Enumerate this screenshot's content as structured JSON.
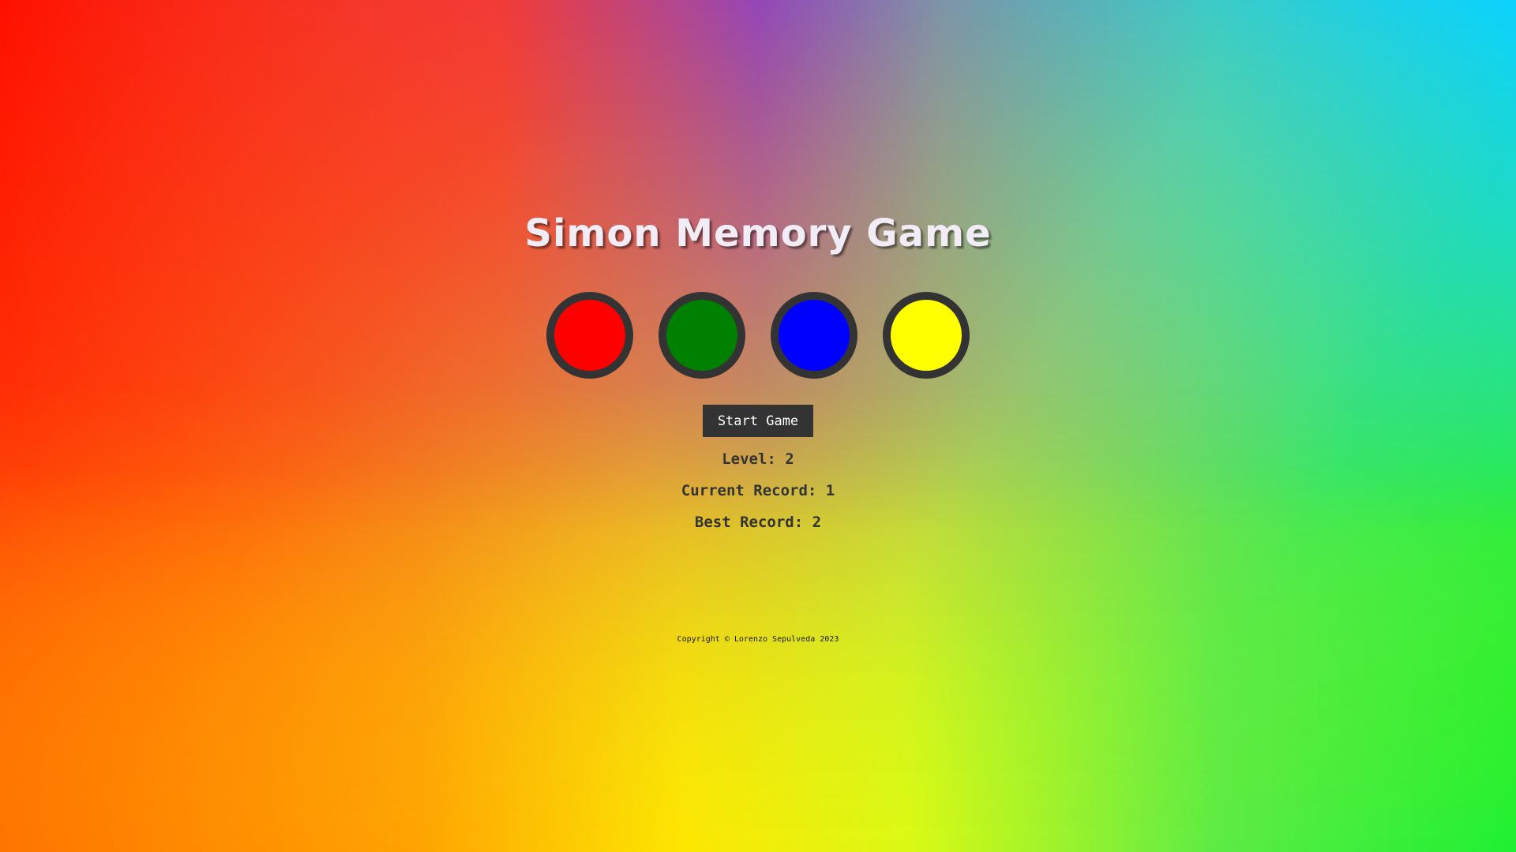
{
  "title": "Simon Memory Game",
  "buttons": [
    {
      "name": "red",
      "color": "#ff0000"
    },
    {
      "name": "green",
      "color": "#008000"
    },
    {
      "name": "blue",
      "color": "#0000ff"
    },
    {
      "name": "yellow",
      "color": "#ffff00"
    }
  ],
  "start_button_label": "Start Game",
  "stats": {
    "level": "Level: 2",
    "current_record": "Current Record: 1",
    "best_record": "Best Record: 2"
  },
  "footer": "Copyright © Lorenzo Sepulveda 2023",
  "colors": {
    "button_border": "#333333",
    "start_button_bg": "#333333",
    "start_button_text": "#ffffff",
    "title_text": "#f2ecf7"
  }
}
